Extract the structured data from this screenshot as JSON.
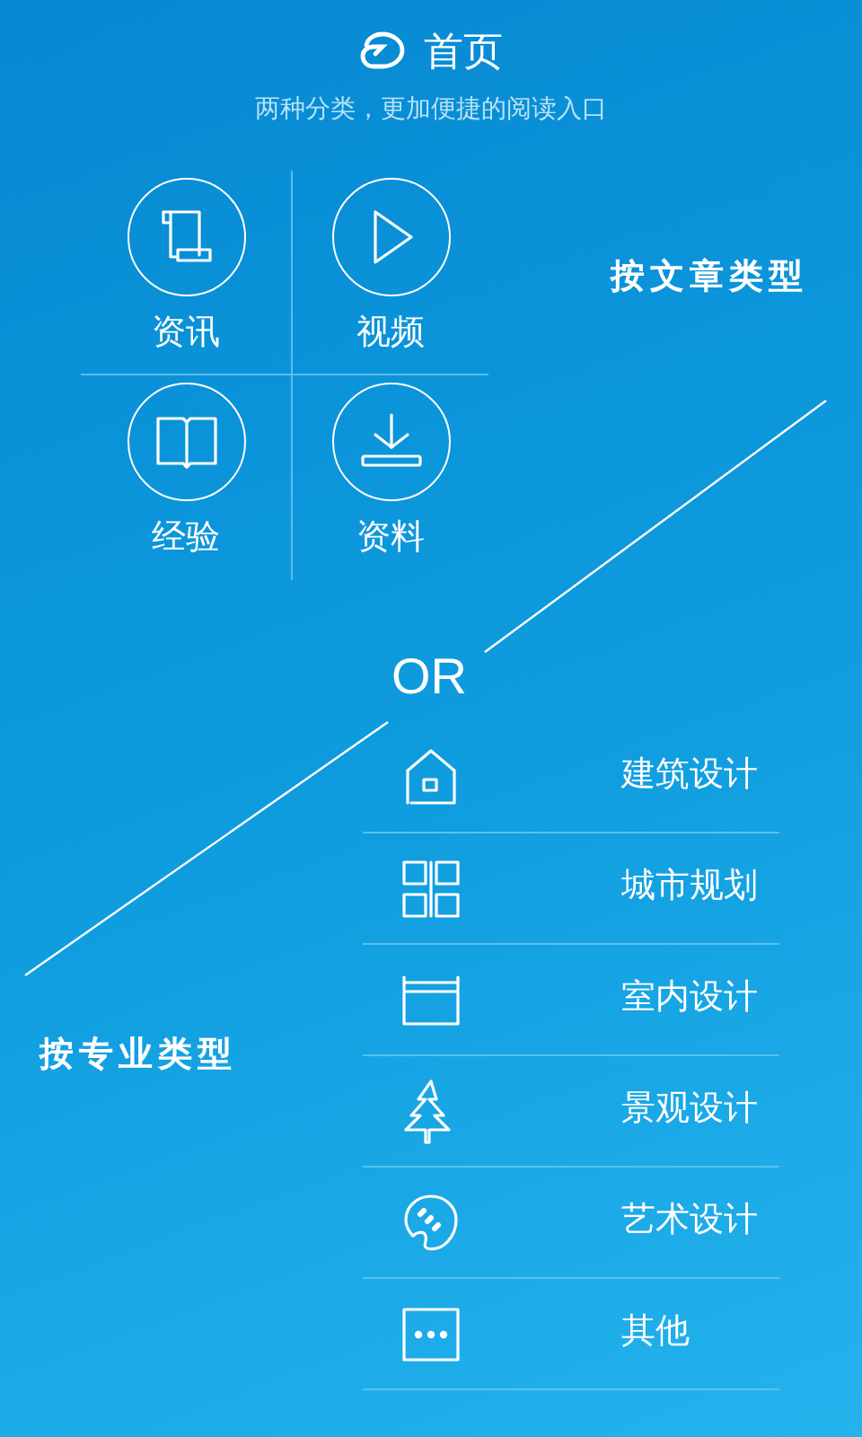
{
  "header": {
    "title": "首页",
    "subtitle": "两种分类，更加便捷的阅读入口"
  },
  "article_types": {
    "label": "按文章类型",
    "items": [
      {
        "label": "资讯",
        "kind": "scroll"
      },
      {
        "label": "视频",
        "kind": "play"
      },
      {
        "label": "经验",
        "kind": "book"
      },
      {
        "label": "资料",
        "kind": "download"
      }
    ]
  },
  "divider_text": "OR",
  "professional_types": {
    "label": "按专业类型",
    "items": [
      {
        "label": "建筑设计",
        "kind": "house"
      },
      {
        "label": "城市规划",
        "kind": "blocks"
      },
      {
        "label": "室内设计",
        "kind": "room"
      },
      {
        "label": "景观设计",
        "kind": "tree"
      },
      {
        "label": "艺术设计",
        "kind": "palette"
      },
      {
        "label": "其他",
        "kind": "more"
      }
    ]
  }
}
